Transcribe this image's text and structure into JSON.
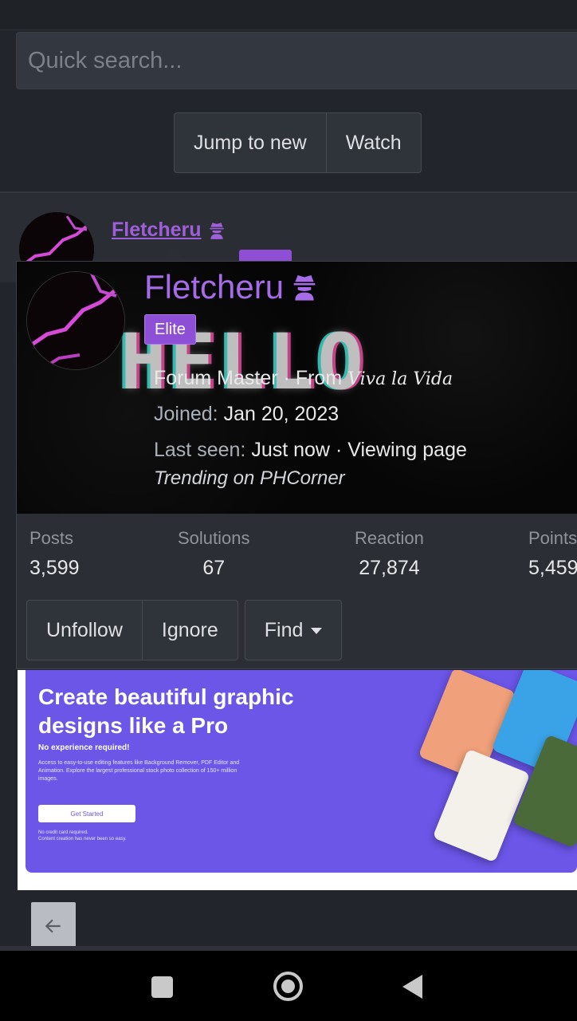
{
  "search": {
    "placeholder": "Quick search..."
  },
  "thread_actions": {
    "jump_label": "Jump to new",
    "watch_label": "Watch"
  },
  "post": {
    "username": "Fletcheru"
  },
  "profile_card": {
    "username": "Fletcheru",
    "role_icon": "detective-icon",
    "badge": "Elite",
    "banner_text": "HELLO",
    "title": "Forum Master",
    "from_label": "From",
    "from_value": "Viva la Vida",
    "joined_label": "Joined:",
    "joined_value": "Jan 20, 2023",
    "last_seen_label": "Last seen:",
    "last_seen_value": "Just now",
    "activity": "Viewing page",
    "trending": "Trending on PHCorner",
    "stats": [
      {
        "label": "Posts",
        "value": "3,599"
      },
      {
        "label": "Solutions",
        "value": "67"
      },
      {
        "label": "Reaction",
        "value": "27,874"
      },
      {
        "label": "Points",
        "value": "5,459"
      }
    ],
    "actions": {
      "unfollow": "Unfollow",
      "ignore": "Ignore",
      "find": "Find"
    }
  },
  "ad": {
    "title": "Create beautiful graphic designs like a Pro",
    "subtitle": "No experience required!",
    "body": "Access to easy-to-use editing features like Background Remover, PDF Editor and Animation. Explore the largest professional stock photo collection of 150+ million images.",
    "cta": "Get Started",
    "footnote_1": "No credit card required.",
    "footnote_2": "Content creation has never been so easy."
  },
  "colors": {
    "page_bg": "#22252b",
    "username": "#a66be6",
    "elite_badge": "#8d4fd6",
    "ad_bg": "#6b56e8"
  },
  "nav": {
    "back_icon": "arrow-left-icon",
    "system_buttons": [
      "recents-icon",
      "home-icon",
      "back-triangle-icon"
    ]
  }
}
